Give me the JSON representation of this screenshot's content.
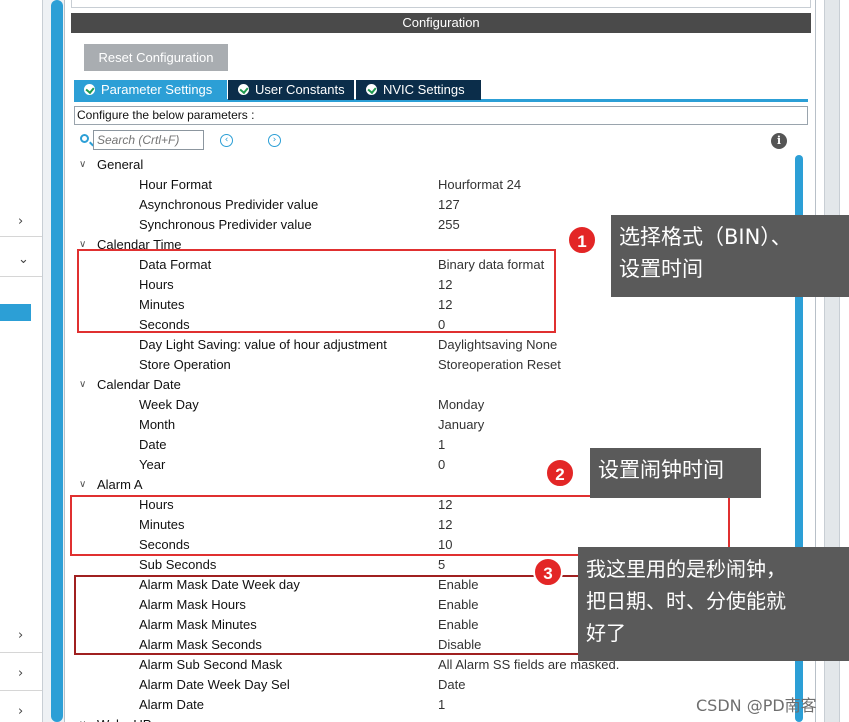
{
  "panel": {
    "title": "Configuration",
    "reset_label": "Reset Configuration",
    "tabs": [
      {
        "label": "Parameter Settings"
      },
      {
        "label": "User Constants"
      },
      {
        "label": "NVIC Settings"
      }
    ],
    "configure_text": "Configure the below parameters :",
    "search_placeholder": "Search (Crtl+F)"
  },
  "tree": {
    "groups": [
      {
        "label": "General",
        "params": [
          {
            "name": "Hour Format",
            "value": "Hourformat 24"
          },
          {
            "name": "Asynchronous Predivider value",
            "value": "127"
          },
          {
            "name": "Synchronous Predivider value",
            "value": "255"
          }
        ]
      },
      {
        "label": "Calendar Time",
        "params": [
          {
            "name": "Data Format",
            "value": "Binary data format"
          },
          {
            "name": "Hours",
            "value": "12"
          },
          {
            "name": "Minutes",
            "value": "12"
          },
          {
            "name": "Seconds",
            "value": "0"
          },
          {
            "name": "Day Light Saving: value of hour adjustment",
            "value": "Daylightsaving None"
          },
          {
            "name": "Store Operation",
            "value": "Storeoperation Reset"
          }
        ]
      },
      {
        "label": "Calendar Date",
        "params": [
          {
            "name": "Week Day",
            "value": "Monday"
          },
          {
            "name": "Month",
            "value": "January"
          },
          {
            "name": "Date",
            "value": "1"
          },
          {
            "name": "Year",
            "value": "0"
          }
        ]
      },
      {
        "label": "Alarm A",
        "params": [
          {
            "name": "Hours",
            "value": "12"
          },
          {
            "name": "Minutes",
            "value": "12"
          },
          {
            "name": "Seconds",
            "value": "10"
          },
          {
            "name": "Sub Seconds",
            "value": "5"
          },
          {
            "name": "Alarm Mask Date Week day",
            "value": "Enable"
          },
          {
            "name": "Alarm Mask Hours",
            "value": "Enable"
          },
          {
            "name": "Alarm Mask Minutes",
            "value": "Enable"
          },
          {
            "name": "Alarm Mask Seconds",
            "value": "Disable"
          },
          {
            "name": "Alarm Sub Second Mask",
            "value": "All Alarm SS fields are masked."
          },
          {
            "name": "Alarm Date Week Day Sel",
            "value": "Date"
          },
          {
            "name": "Alarm Date",
            "value": "1"
          }
        ]
      },
      {
        "label": "Wake UP",
        "params": []
      }
    ]
  },
  "annotations": {
    "badge1": "1",
    "callout1_line1": "选择格式（BIN）、",
    "callout1_line2": "设置时间",
    "badge2": "2",
    "callout2": "设置闹钟时间",
    "badge3": "3",
    "callout3_line1": "我这里用的是秒闹钟，",
    "callout3_line2": "把日期、时、分使能就",
    "callout3_line3": "好了"
  },
  "watermark": "CSDN @PD南客",
  "colors": {
    "accent": "#2c9fd6",
    "tab_dark": "#0b2d4a",
    "header_bar": "#4a4a4a",
    "annotation_red": "#e03030",
    "callout_bg": "#5a5a5a"
  }
}
